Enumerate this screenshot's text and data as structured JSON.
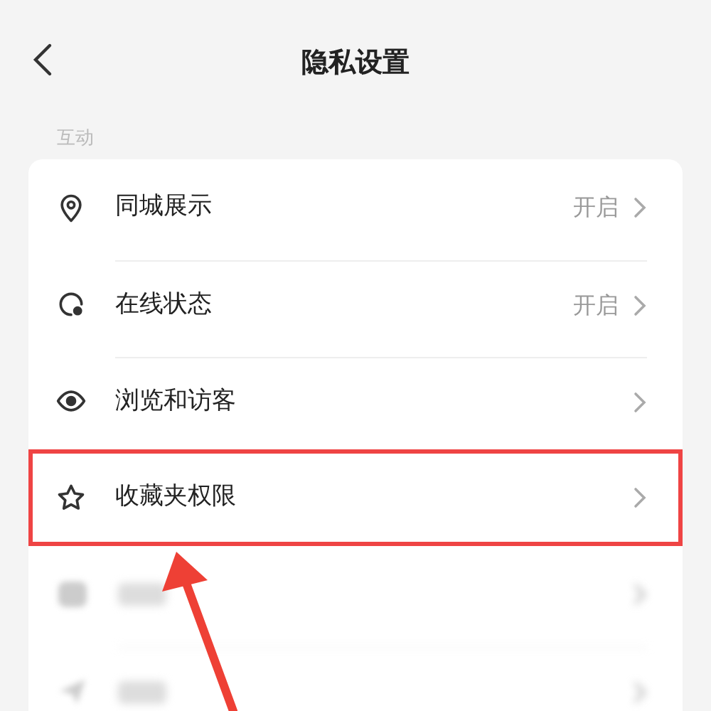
{
  "header": {
    "title": "隐私设置"
  },
  "section": {
    "label": "互动"
  },
  "rows": [
    {
      "kind": "location",
      "label": "同城展示",
      "value": "开启",
      "highlighted": false,
      "blurred": false
    },
    {
      "kind": "status",
      "label": "在线状态",
      "value": "开启",
      "highlighted": false,
      "blurred": false
    },
    {
      "kind": "eye",
      "label": "浏览和访客",
      "highlighted": false,
      "blurred": false
    },
    {
      "kind": "star",
      "label": "收藏夹权限",
      "highlighted": true,
      "blurred": false
    },
    {
      "kind": "like",
      "highlighted": false,
      "blurred": true
    },
    {
      "kind": "message",
      "highlighted": false,
      "blurred": true
    }
  ]
}
